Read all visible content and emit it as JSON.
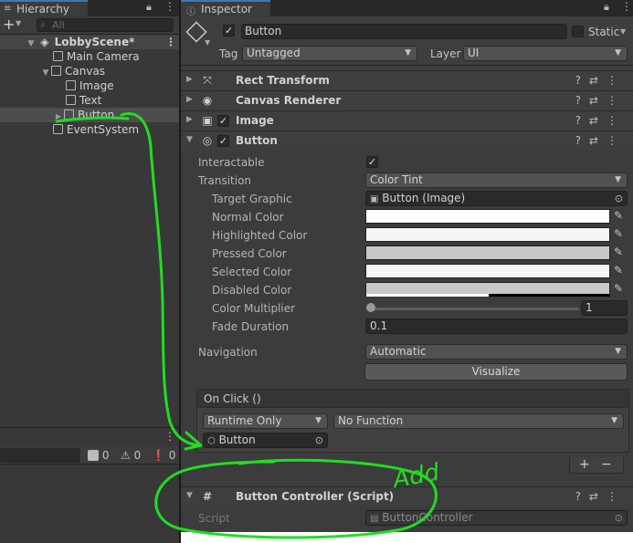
{
  "hierarchy": {
    "tab_label": "Hierarchy",
    "add_label": "+",
    "search_placeholder": "All",
    "scene": "LobbyScene*",
    "items": [
      {
        "label": "Main Camera",
        "depth": 1
      },
      {
        "label": "Canvas",
        "depth": 1
      },
      {
        "label": "Image",
        "depth": 2
      },
      {
        "label": "Text",
        "depth": 2
      },
      {
        "label": "Button",
        "depth": 2
      },
      {
        "label": "EventSystem",
        "depth": 1
      }
    ]
  },
  "console": {
    "log_count": "0",
    "warning_count": "0",
    "error_count": "0"
  },
  "inspector": {
    "tab_label": "Inspector",
    "object_name": "Button",
    "static_label": "Static",
    "tag_label": "Tag",
    "tag_value": "Untagged",
    "layer_label": "Layer",
    "layer_value": "UI",
    "components": {
      "rect_transform": "Rect Transform",
      "canvas_renderer": "Canvas Renderer",
      "image": "Image",
      "button": "Button",
      "button_controller": "Button Controller (Script)"
    },
    "button": {
      "interactable_label": "Interactable",
      "transition_label": "Transition",
      "transition_value": "Color Tint",
      "target_graphic_label": "Target Graphic",
      "target_graphic_value": "Button (Image)",
      "normal_color_label": "Normal Color",
      "highlighted_color_label": "Highlighted Color",
      "pressed_color_label": "Pressed Color",
      "selected_color_label": "Selected Color",
      "disabled_color_label": "Disabled Color",
      "color_multiplier_label": "Color Multiplier",
      "color_multiplier_value": "1",
      "fade_duration_label": "Fade Duration",
      "fade_duration_value": "0.1",
      "navigation_label": "Navigation",
      "navigation_value": "Automatic",
      "visualize_label": "Visualize"
    },
    "on_click": {
      "header": "On Click ()",
      "runtime_value": "Runtime Only",
      "function_value": "No Function",
      "object_value": "Button",
      "add_label": "+",
      "remove_label": "−"
    },
    "script": {
      "label": "Script",
      "value": "ButtonController"
    }
  },
  "annotation": {
    "text": "Add",
    "color": "#22dd22"
  },
  "colors": {
    "normal": "#ffffff",
    "highlighted": "#f5f5f5",
    "pressed": "#c8c8c8",
    "selected": "#f5f5f5",
    "disabled": "#c8c8c8"
  }
}
